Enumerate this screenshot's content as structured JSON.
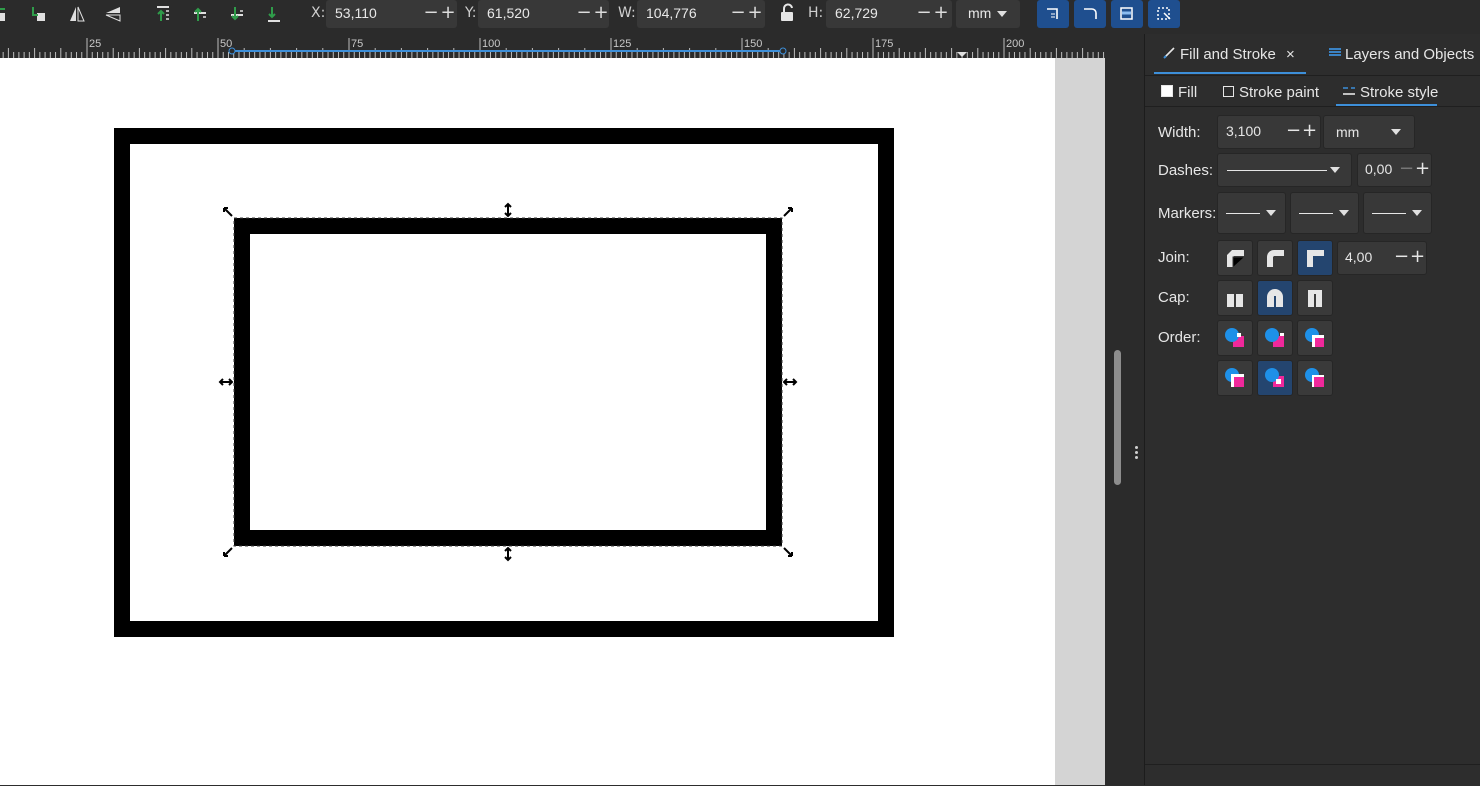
{
  "toolbar": {
    "x": {
      "label": "X:",
      "value": "53,110"
    },
    "y": {
      "label": "Y:",
      "value": "61,520"
    },
    "w": {
      "label": "W:",
      "value": "104,776"
    },
    "h": {
      "label": "H:",
      "value": "62,729"
    },
    "unit": "mm",
    "minus": "−",
    "plus": "+"
  },
  "ruler": {
    "ticks": [
      "25",
      "50",
      "75",
      "100",
      "125",
      "150",
      "175",
      "200"
    ]
  },
  "dock": {
    "tabs": [
      {
        "label": "Fill and Stroke",
        "close": "×"
      },
      {
        "label": "Layers and Objects",
        "close": "×"
      }
    ],
    "subtabs": [
      "Fill",
      "Stroke paint",
      "Stroke style"
    ],
    "width": {
      "label": "Width:",
      "value": "3,100",
      "unit": "mm"
    },
    "dashes": {
      "label": "Dashes:",
      "offset": "0,00"
    },
    "markers": {
      "label": "Markers:"
    },
    "join": {
      "label": "Join:",
      "miter_limit": "4,00"
    },
    "cap": {
      "label": "Cap:"
    },
    "order": {
      "label": "Order:"
    }
  },
  "colors": {
    "accent": "#3d8fd9",
    "active_button": "#24456f",
    "order_blue": "#1e90e8",
    "order_pink": "#f0289b"
  }
}
